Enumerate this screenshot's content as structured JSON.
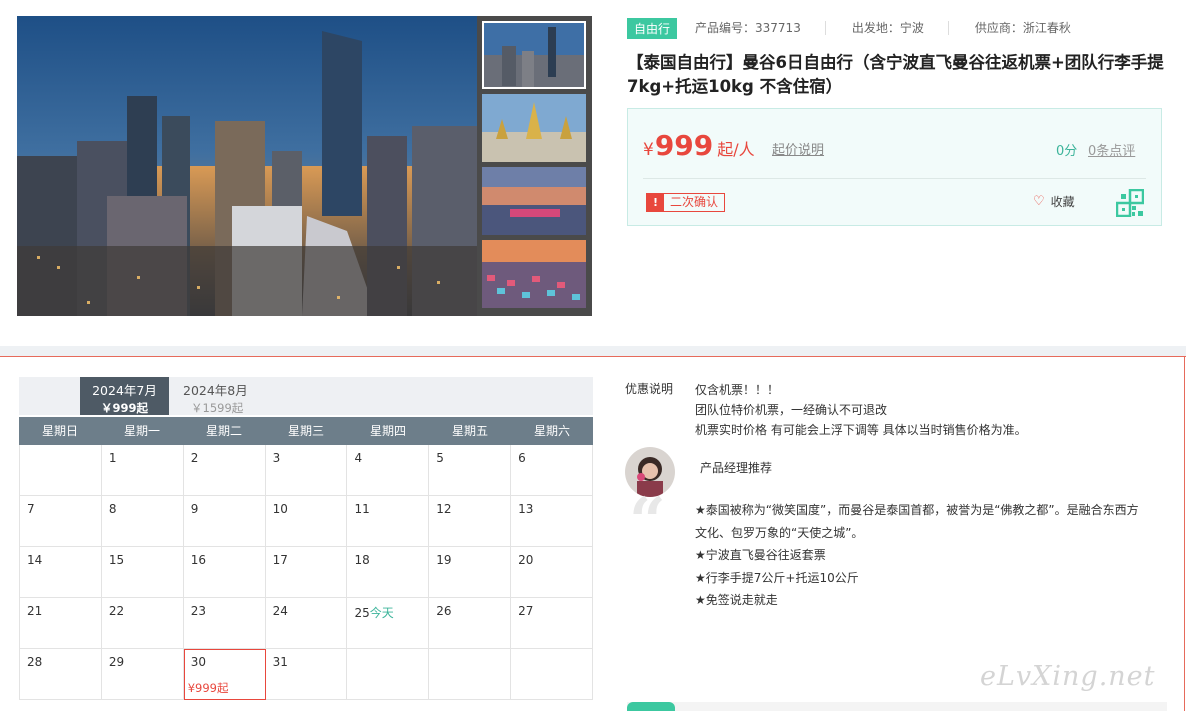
{
  "gallery": {
    "main_image": "bangkok-skyline-night-photo",
    "thumbnails": [
      "bangkok-skyline-thumb",
      "grand-palace-thumb",
      "river-cruise-thumb",
      "night-market-thumb"
    ]
  },
  "product": {
    "tag": "自由行",
    "code": "产品编号：337713",
    "departure": "出发地：宁波",
    "supplier": "供应商：浙江春秋",
    "title": "【泰国自由行】曼谷6日自由行（含宁波直飞曼谷往返机票+团队行李手提7kg+托运10kg 不含住宿）",
    "price_currency": "¥",
    "price_value": "999",
    "price_unit": "起/人",
    "price_note": "起价说明",
    "score": "0分",
    "reviews": "0条点评",
    "confirm_icon": "!",
    "confirm_label": "二次确认",
    "favorite_label": "收藏"
  },
  "calendar": {
    "months": [
      {
        "label": "2024年7月",
        "price": "￥999起"
      },
      {
        "label": "2024年8月",
        "price": "￥1599起"
      }
    ],
    "weekdays": [
      "星期日",
      "星期一",
      "星期二",
      "星期三",
      "星期四",
      "星期五",
      "星期六"
    ],
    "weeks": [
      [
        "",
        "1",
        "2",
        "3",
        "4",
        "5",
        "6"
      ],
      [
        "7",
        "8",
        "9",
        "10",
        "11",
        "12",
        "13"
      ],
      [
        "14",
        "15",
        "16",
        "17",
        "18",
        "19",
        "20"
      ],
      [
        "21",
        "22",
        "23",
        "24",
        "25",
        "26",
        "27"
      ],
      [
        "28",
        "29",
        "30",
        "31",
        "",
        "",
        ""
      ]
    ],
    "today_label": "今天",
    "today_day": "25",
    "selected_day": "30",
    "selected_price": "¥999起"
  },
  "info": {
    "promo_label": "优惠说明",
    "promo_lines": [
      "仅含机票！！！",
      "团队位特价机票，一经确认不可退改",
      "机票实时价格 有可能会上浮下调等 具体以当时销售价格为准。"
    ],
    "manager_title": "产品经理推荐",
    "quote_mark": "“",
    "recommend_lines": [
      "★泰国被称为“微笑国度”，而曼谷是泰国首都，被誉为是“佛教之都”。是融合东西方文化、包罗万象的“天使之城”。",
      "★宁波直飞曼谷往返套票",
      "★行李手提7公斤+托运10公斤",
      "★免签说走就走"
    ],
    "watermark": "eLvXing.net"
  },
  "colors": {
    "accent_green": "#3cc8a0",
    "price_red": "#e8473d",
    "calendar_header": "#6d7e8a",
    "active_month": "#4e5a65"
  }
}
